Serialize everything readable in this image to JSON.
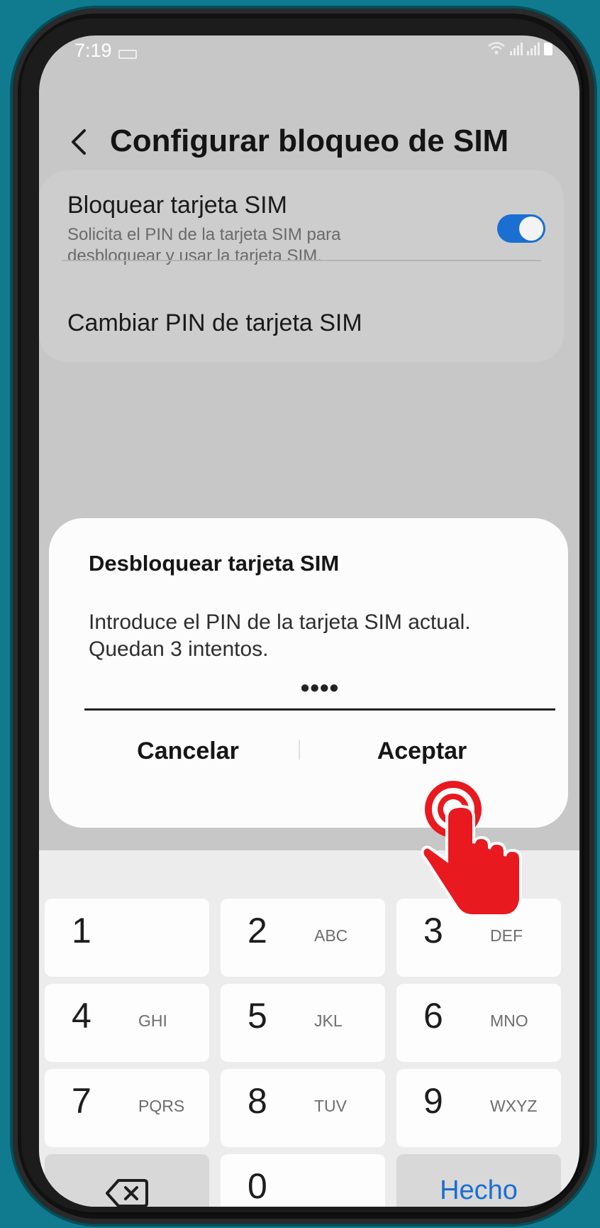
{
  "status_bar": {
    "time": "7:19"
  },
  "header": {
    "title": "Configurar bloqueo de SIM"
  },
  "settings": {
    "lock_sim": {
      "title": "Bloquear tarjeta SIM",
      "subtitle_line1": "Solicita el PIN de la tarjeta SIM para",
      "subtitle_line2": "desbloquear y usar la tarjeta SIM.",
      "enabled": true
    },
    "change_pin": {
      "title": "Cambiar PIN de tarjeta SIM"
    }
  },
  "dialog": {
    "title": "Desbloquear tarjeta SIM",
    "message_line1": "Introduce el PIN de la tarjeta SIM actual.",
    "message_line2": "Quedan 3 intentos.",
    "pin_value": "••••",
    "cancel_label": "Cancelar",
    "accept_label": "Aceptar"
  },
  "keypad": {
    "keys": [
      {
        "num": "1",
        "letters": ""
      },
      {
        "num": "2",
        "letters": "ABC"
      },
      {
        "num": "3",
        "letters": "DEF"
      },
      {
        "num": "4",
        "letters": "GHI"
      },
      {
        "num": "5",
        "letters": "JKL"
      },
      {
        "num": "6",
        "letters": "MNO"
      },
      {
        "num": "7",
        "letters": "PQRS"
      },
      {
        "num": "8",
        "letters": "TUV"
      },
      {
        "num": "9",
        "letters": "WXYZ"
      },
      {
        "num": "0",
        "letters": ""
      }
    ],
    "done_label": "Hecho",
    "backspace_icon": "backspace-icon"
  },
  "colors": {
    "accent": "#1a6fd0",
    "background": "#107b8e",
    "tap_indicator": "#e8191f"
  }
}
